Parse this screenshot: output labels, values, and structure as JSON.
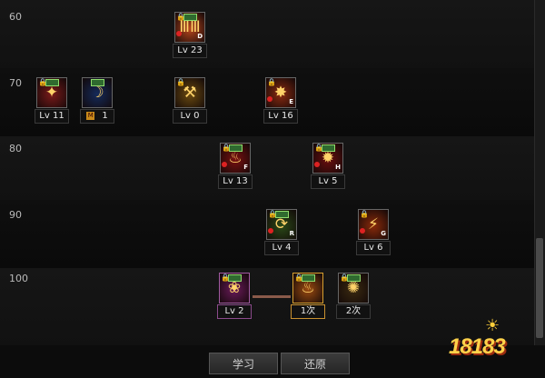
{
  "levels": [
    "60",
    "70",
    "80",
    "90",
    "100"
  ],
  "skills": [
    {
      "id": "s60a",
      "level_text": "Lv 23",
      "key": "D",
      "color": "#b8451c",
      "glyph": "ⅢⅢ"
    },
    {
      "id": "s70a",
      "level_text": "Lv 11",
      "key": "",
      "color": "#7a1a1a",
      "glyph": "✦"
    },
    {
      "id": "s70b",
      "level_text": "1",
      "key": "",
      "color": "#142a5a",
      "glyph": "☽",
      "badge": "M"
    },
    {
      "id": "s70c",
      "level_text": "Lv 0",
      "key": "",
      "color": "#6a4a10",
      "glyph": "⚒"
    },
    {
      "id": "s70d",
      "level_text": "Lv 16",
      "key": "E",
      "color": "#8a2a10",
      "glyph": "✸"
    },
    {
      "id": "s80a",
      "level_text": "Lv 13",
      "key": "F",
      "color": "#7a1010",
      "glyph": "♨"
    },
    {
      "id": "s80b",
      "level_text": "Lv 5",
      "key": "H",
      "color": "#6a0e0e",
      "glyph": "✹"
    },
    {
      "id": "s90a",
      "level_text": "Lv 4",
      "key": "R",
      "color": "#2a4a18",
      "glyph": "⟳"
    },
    {
      "id": "s90b",
      "level_text": "Lv 6",
      "key": "G",
      "color": "#8a2a0a",
      "glyph": "⚡"
    },
    {
      "id": "s100a",
      "level_text": "Lv 2",
      "key": "",
      "color": "#6a1a5a",
      "glyph": "❀"
    },
    {
      "id": "s100b",
      "level_text": "1次",
      "key": "",
      "color": "#9a4a10",
      "glyph": "♨"
    },
    {
      "id": "s100c",
      "level_text": "2次",
      "key": "",
      "color": "#3a2a10",
      "glyph": "✺"
    }
  ],
  "buttons": {
    "learn": "学习",
    "reset": "还原"
  },
  "logo": {
    "text": "18183"
  }
}
